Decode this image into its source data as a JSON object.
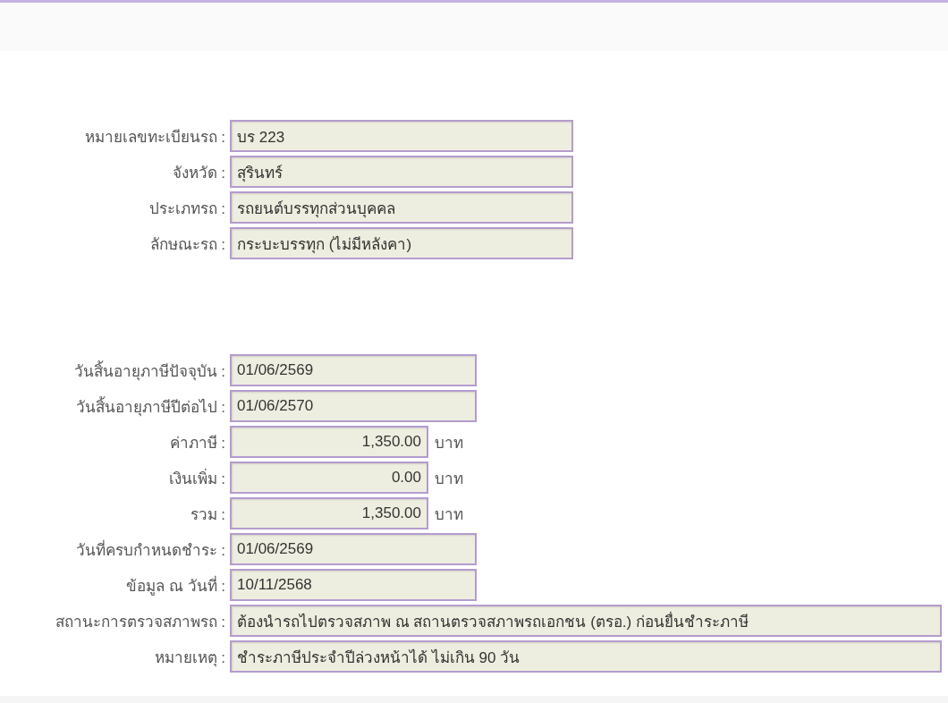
{
  "sections": [
    {
      "rows": [
        {
          "label": "หมายเลขทะเบียนรถ :",
          "value": "บร 223",
          "kind": "wide"
        },
        {
          "label": "จังหวัด :",
          "value": "สุรินทร์",
          "kind": "wide"
        },
        {
          "label": "ประเภทรถ :",
          "value": "รถยนต์บรรทุกส่วนบุคคล",
          "kind": "wide"
        },
        {
          "label": "ลักษณะรถ :",
          "value": "กระบะบรรทุก (ไม่มีหลังคา)",
          "kind": "wide"
        }
      ]
    },
    {
      "rows": [
        {
          "label": "วันสิ้นอายุภาษีปัจจุบัน :",
          "value": "01/06/2569",
          "kind": "date"
        },
        {
          "label": "วันสิ้นอายุภาษีปีต่อไป :",
          "value": "01/06/2570",
          "kind": "date"
        },
        {
          "label": "ค่าภาษี :",
          "value": "1,350.00",
          "kind": "amount",
          "unit": "บาท"
        },
        {
          "label": "เงินเพิ่ม :",
          "value": "0.00",
          "kind": "amount",
          "unit": "บาท"
        },
        {
          "label": "รวม :",
          "value": "1,350.00",
          "kind": "amount",
          "unit": "บาท"
        },
        {
          "label": "วันที่ครบกำหนดชำระ :",
          "value": "01/06/2569",
          "kind": "date"
        },
        {
          "label": "ข้อมูล ณ วันที่ :",
          "value": "10/11/2568",
          "kind": "date"
        },
        {
          "label": "สถานะการตรวจสภาพรถ :",
          "value": "ต้องนำรถไปตรวจสภาพ ณ สถานตรวจสภาพรถเอกชน (ตรอ.) ก่อนยื่นชำระภาษี",
          "kind": "full"
        },
        {
          "label": "หมายเหตุ :",
          "value": "ชำระภาษีประจำปีล่วงหน้าได้ ไม่เกิน 90 วัน",
          "kind": "full"
        }
      ]
    }
  ]
}
